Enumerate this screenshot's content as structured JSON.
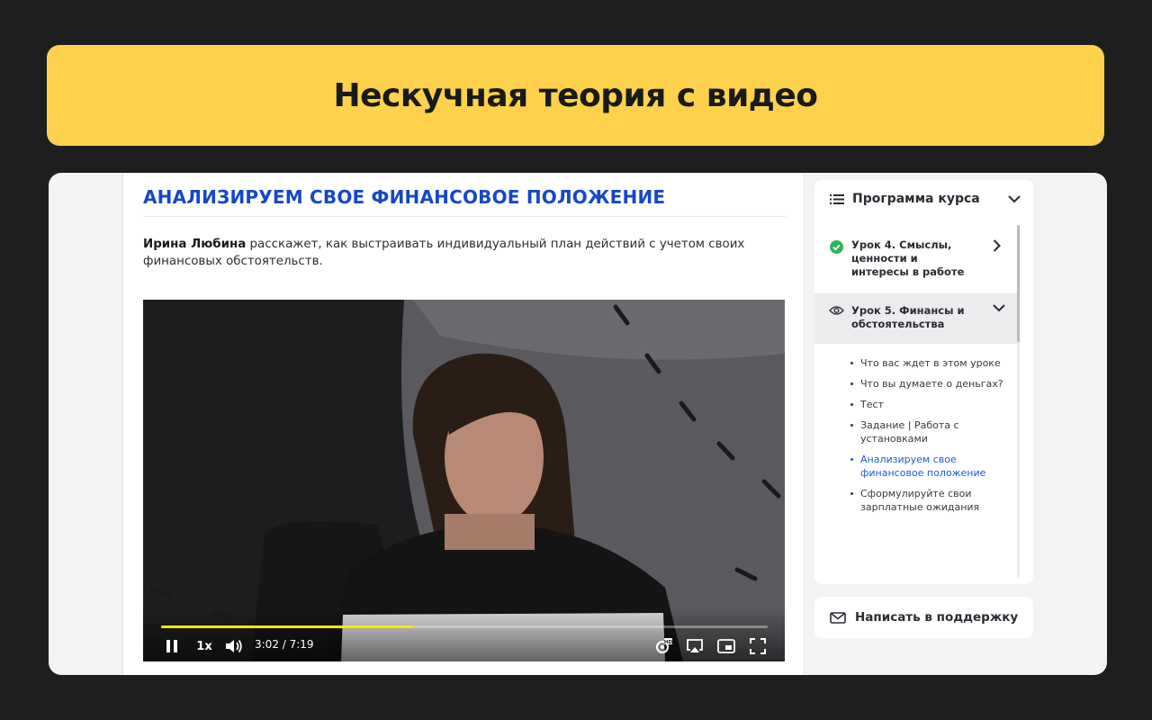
{
  "banner": {
    "title": "Нескучная теория с видео"
  },
  "lesson": {
    "title": "АНАЛИЗИРУЕМ СВОЕ ФИНАНСОВОЕ ПОЛОЖЕНИЕ",
    "author": "Ирина Любина",
    "description": " расскажет, как выстраивать индивидуальный план действий с учетом своих финансовых обстоятельств."
  },
  "video": {
    "speed": "1x",
    "time": "3:02 / 7:19",
    "progress": 0.415,
    "accent_color": "#ffe600"
  },
  "sidebar": {
    "header": "Программа курса",
    "lessons": [
      {
        "label": "Урок 4. Смыслы, ценности и интересы в работе",
        "status": "completed"
      },
      {
        "label": "Урок 5. Финансы и обстоятельства",
        "status": "viewing"
      }
    ],
    "sub_items": [
      {
        "label": "Что вас ждет в этом уроке"
      },
      {
        "label": "Что вы думаете о деньгах?"
      },
      {
        "label": "Тест"
      },
      {
        "label": "Задание | Работа с установками"
      },
      {
        "label": "Анализируем свое финансовое положение",
        "active": true
      },
      {
        "label": "Сформулируйте свои зарплатные ожидания"
      }
    ],
    "active_color": "#1f5bd6",
    "completed_color": "#2fb45c"
  },
  "support": {
    "label": "Написать в поддержку"
  }
}
